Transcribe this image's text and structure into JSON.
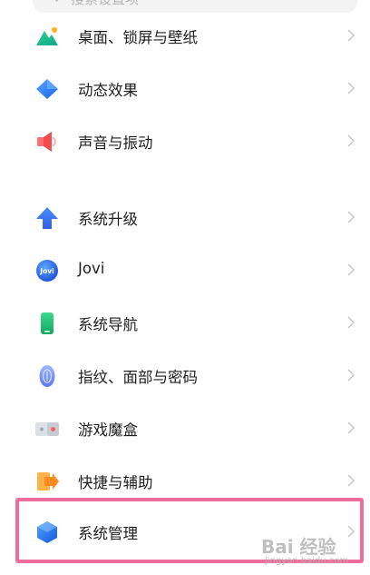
{
  "search": {
    "placeholder": "搜索设置项"
  },
  "settings": [
    {
      "id": "wallpaper",
      "label": "桌面、锁屏与壁纸",
      "icon": "landscape-icon"
    },
    {
      "id": "animation",
      "label": "动态效果",
      "icon": "diamond-icon"
    },
    {
      "id": "sound",
      "label": "声音与振动",
      "icon": "speaker-icon"
    },
    {
      "id": "upgrade",
      "label": "系统升级",
      "icon": "arrow-up-icon"
    },
    {
      "id": "jovi",
      "label": "Jovi",
      "icon": "jovi-icon",
      "icon_text": "Jovi"
    },
    {
      "id": "navigation",
      "label": "系统导航",
      "icon": "phone-icon"
    },
    {
      "id": "biometrics",
      "label": "指纹、面部与密码",
      "icon": "fingerprint-icon"
    },
    {
      "id": "game",
      "label": "游戏魔盒",
      "icon": "game-box-icon"
    },
    {
      "id": "shortcuts",
      "label": "快捷与辅助",
      "icon": "shortcut-arrow-icon"
    },
    {
      "id": "system_mgmt",
      "label": "系统管理",
      "icon": "hexagon-icon",
      "highlighted": true
    }
  ],
  "watermark": {
    "main": "Bai 经验",
    "sub": "jingyan.baidu.com"
  },
  "colors": {
    "highlight_border": "#f06c9b",
    "chevron": "#c4c4c4",
    "accent_blue": "#3a7cf5"
  }
}
